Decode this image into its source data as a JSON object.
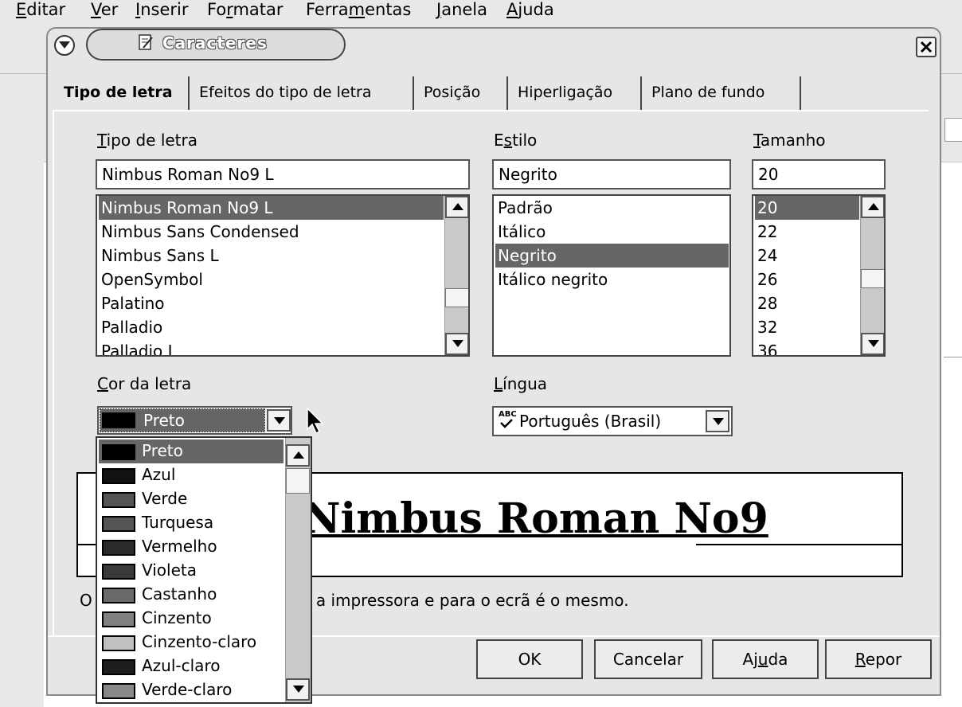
{
  "app_menu": {
    "items": [
      {
        "label": "Editar",
        "accel": "E"
      },
      {
        "label": "Ver",
        "accel": "V"
      },
      {
        "label": "Inserir",
        "accel": "I"
      },
      {
        "label": "Formatar",
        "accel": "r"
      },
      {
        "label": "Ferramentas",
        "accel": "m"
      },
      {
        "label": "Janela",
        "accel": "J"
      },
      {
        "label": "Ajuda",
        "accel": "A"
      }
    ]
  },
  "dialog": {
    "title": "Caracteres",
    "title_icon": "document-edit-icon",
    "tabs": [
      {
        "label": "Tipo de letra",
        "active": true
      },
      {
        "label": "Efeitos do tipo de letra",
        "active": false
      },
      {
        "label": "Posição",
        "active": false
      },
      {
        "label": "Hiperligação",
        "active": false
      },
      {
        "label": "Plano de fundo",
        "active": false
      }
    ],
    "font": {
      "label": "Tipo de letra",
      "value": "Nimbus Roman No9 L",
      "options": [
        "Nimbus Roman No9 L",
        "Nimbus Sans Condensed",
        "Nimbus Sans L",
        "OpenSymbol",
        "Palatino",
        "Palladio",
        "Palladio L"
      ],
      "selected": "Nimbus Roman No9 L"
    },
    "style": {
      "label": "Estilo",
      "value": "Negrito",
      "options": [
        "Padrão",
        "Itálico",
        "Negrito",
        "Itálico negrito"
      ],
      "selected": "Negrito"
    },
    "size": {
      "label": "Tamanho",
      "value": "20",
      "options": [
        "20",
        "22",
        "24",
        "26",
        "28",
        "32",
        "36"
      ],
      "selected": "20"
    },
    "font_color": {
      "label": "Cor da letra",
      "value": "Preto",
      "options": [
        {
          "label": "Preto",
          "color": "#000000"
        },
        {
          "label": "Azul",
          "color": "#111111"
        },
        {
          "label": "Verde",
          "color": "#555555"
        },
        {
          "label": "Turquesa",
          "color": "#555555"
        },
        {
          "label": "Vermelho",
          "color": "#2a2a2a"
        },
        {
          "label": "Violeta",
          "color": "#3a3a3a"
        },
        {
          "label": "Castanho",
          "color": "#6a6a6a"
        },
        {
          "label": "Cinzento",
          "color": "#808080"
        },
        {
          "label": "Cinzento-claro",
          "color": "#c0c0c0"
        },
        {
          "label": "Azul-claro",
          "color": "#1e1e1e"
        },
        {
          "label": "Verde-claro",
          "color": "#888888"
        }
      ]
    },
    "language": {
      "label": "Língua",
      "value": "Português (Brasil)",
      "icon": "spellcheck-icon",
      "icon_text": "ABC"
    },
    "preview": {
      "text": "Nimbus Roman No9"
    },
    "info_text": "O                                        ra a impressora e para o ecrã é o mesmo.",
    "info_prefix": "O",
    "info_suffix": "ra a impressora e para o ecrã é o mesmo.",
    "buttons": {
      "ok": "OK",
      "cancel": "Cancelar",
      "help": "Ajuda",
      "reset": "Repor"
    }
  },
  "colors": {
    "selection": "#666666",
    "dialog_bg": "#e6e6e6"
  }
}
